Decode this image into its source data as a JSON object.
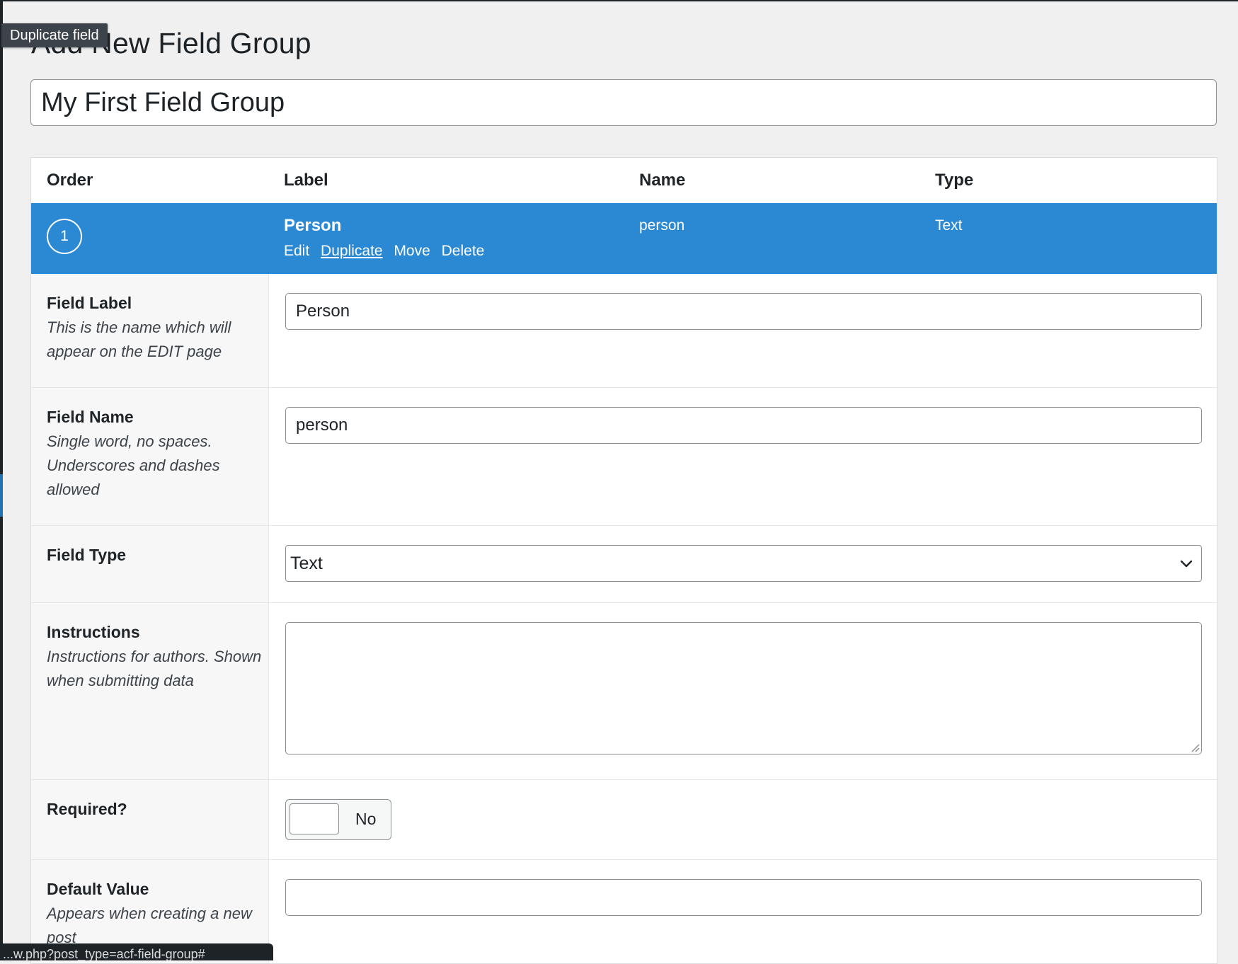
{
  "page": {
    "title": "Add New Field Group",
    "tooltip": "Duplicate field"
  },
  "group_title": {
    "value": "My First Field Group"
  },
  "table": {
    "headers": {
      "order": "Order",
      "label": "Label",
      "name": "Name",
      "type": "Type"
    }
  },
  "field": {
    "order": "1",
    "label": "Person",
    "name": "person",
    "type": "Text",
    "actions": {
      "edit": "Edit",
      "duplicate": "Duplicate",
      "move": "Move",
      "delete": "Delete"
    }
  },
  "settings": {
    "field_label": {
      "title": "Field Label",
      "description": "This is the name which will appear on the EDIT page",
      "value": "Person"
    },
    "field_name": {
      "title": "Field Name",
      "description": "Single word, no spaces. Underscores and dashes allowed",
      "value": "person"
    },
    "field_type": {
      "title": "Field Type",
      "selected": "Text"
    },
    "instructions": {
      "title": "Instructions",
      "description": "Instructions for authors. Shown when submitting data",
      "value": ""
    },
    "required": {
      "title": "Required?",
      "toggle_text": "No"
    },
    "default_value": {
      "title": "Default Value",
      "description": "Appears when creating a new post",
      "value": ""
    }
  },
  "status_bar": {
    "text": "...w.php?post_type=acf-field-group#"
  },
  "colors": {
    "accent": "#2b89d4",
    "admin_bar": "#1d2327",
    "background": "#f0f0f1"
  },
  "icons": {
    "select": "chevron-down-icon",
    "resize": "resize-grip-icon"
  }
}
